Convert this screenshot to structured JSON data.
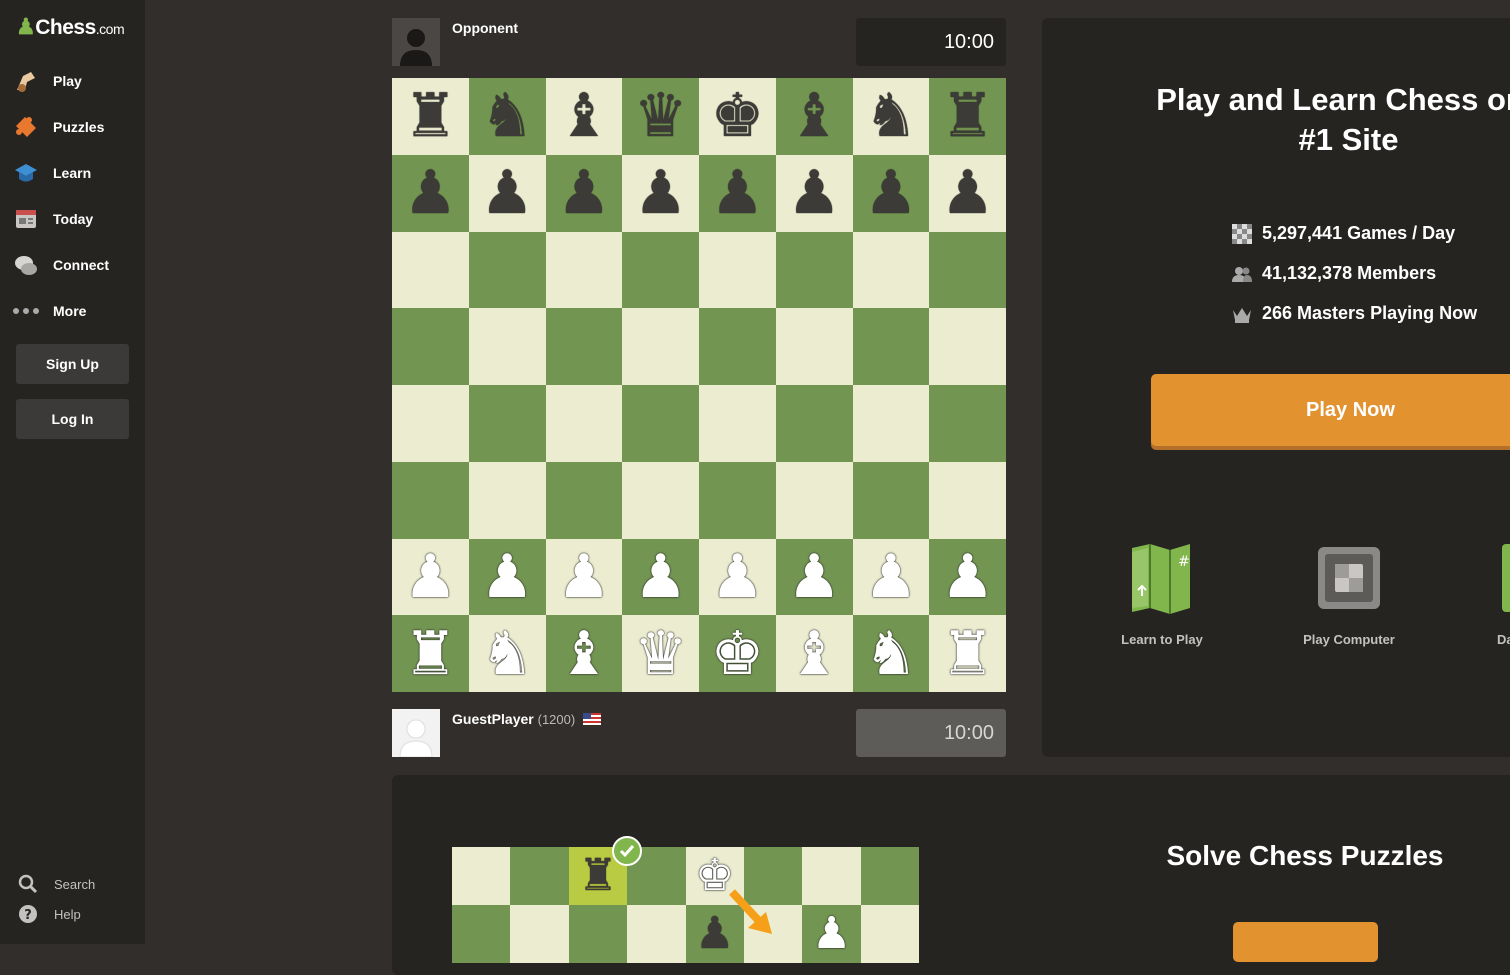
{
  "sidebar": {
    "logo": {
      "brand": "Chess",
      "suffix": ".com"
    },
    "nav": [
      {
        "label": "Play",
        "icon": "play-icon"
      },
      {
        "label": "Puzzles",
        "icon": "puzzle-icon"
      },
      {
        "label": "Learn",
        "icon": "learn-icon"
      },
      {
        "label": "Today",
        "icon": "news-icon"
      },
      {
        "label": "Connect",
        "icon": "chat-icon"
      },
      {
        "label": "More",
        "icon": "more-icon"
      }
    ],
    "signup_label": "Sign Up",
    "login_label": "Log In",
    "search_label": "Search",
    "help_label": "Help"
  },
  "game": {
    "opponent": {
      "name": "Opponent",
      "clock": "10:00"
    },
    "player": {
      "name": "GuestPlayer",
      "rating": "(1200)",
      "clock": "10:00",
      "flag": "us-flag-icon"
    },
    "board_colors": {
      "light": "#ebecd0",
      "dark": "#739552"
    },
    "ranks": [
      [
        "♜",
        "♞",
        "♝",
        "♛",
        "♚",
        "♝",
        "♞",
        "♜"
      ],
      [
        "♟",
        "♟",
        "♟",
        "♟",
        "♟",
        "♟",
        "♟",
        "♟"
      ],
      [
        "",
        "",
        "",
        "",
        "",
        "",
        "",
        ""
      ],
      [
        "",
        "",
        "",
        "",
        "",
        "",
        "",
        ""
      ],
      [
        "",
        "",
        "",
        "",
        "",
        "",
        "",
        ""
      ],
      [
        "",
        "",
        "",
        "",
        "",
        "",
        "",
        ""
      ],
      [
        "♙",
        "♙",
        "♙",
        "♙",
        "♙",
        "♙",
        "♙",
        "♙"
      ],
      [
        "♖",
        "♘",
        "♗",
        "♕",
        "♔",
        "♗",
        "♘",
        "♖"
      ]
    ]
  },
  "hero": {
    "title_line1": "Play and Learn Chess on t",
    "title_line2": "#1 Site",
    "stats": [
      {
        "icon": "board-icon",
        "text": "5,297,441 Games / Day"
      },
      {
        "icon": "members-icon",
        "text": "41,132,378 Members"
      },
      {
        "icon": "crown-icon",
        "text": "266 Masters Playing Now"
      }
    ],
    "play_now_label": "Play Now",
    "features": [
      {
        "label": "Learn to Play",
        "icon": "map-icon"
      },
      {
        "label": "Play Computer",
        "icon": "computer-chip-icon"
      },
      {
        "label": "Da",
        "icon": "daily-icon"
      }
    ],
    "accent": "#e39230"
  },
  "puzzles": {
    "title": "Solve Chess Puzzles"
  }
}
